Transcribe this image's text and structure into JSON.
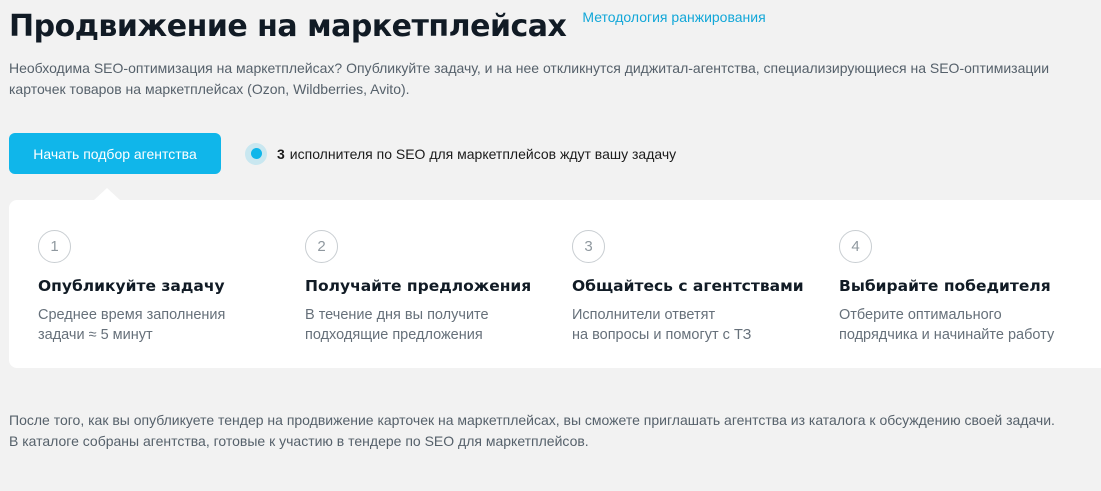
{
  "header": {
    "title": "Продвижение на маркетплейсах",
    "methodology_link": "Методология ранжирования"
  },
  "intro": {
    "text": "Необходима SEO-оптимизация на маркетплейсах? Опубликуйте задачу, и на нее откликнутся диджитал-агентства, специализирующиеся на SEO-оптимизации карточек товаров на маркетплейсах (Ozon, Wildberries, Avito)."
  },
  "cta": {
    "button_label": "Начать подбор агентства",
    "status_count": "3",
    "status_text": "исполнителя по SEO для маркетплейсов ждут вашу задачу"
  },
  "steps": [
    {
      "number": "1",
      "title": "Опубликуйте задачу",
      "desc_line1": "Среднее время заполнения",
      "desc_line2": "задачи ≈ 5 минут"
    },
    {
      "number": "2",
      "title": "Получайте предложения",
      "desc_line1": "В течение дня вы получите",
      "desc_line2": "подходящие предложения"
    },
    {
      "number": "3",
      "title": "Общайтесь с агентствами",
      "desc_line1": "Исполнители ответят",
      "desc_line2": "на вопросы и помогут с ТЗ"
    },
    {
      "number": "4",
      "title": "Выбирайте победителя",
      "desc_line1": "Отберите оптимального",
      "desc_line2": "подрядчика и начинайте работу"
    }
  ],
  "footer": {
    "paragraph1": "После того, как вы опубликуете тендер на продвижение карточек на маркетплейсах, вы сможете приглашать агентства из каталога к обсуждению своей задачи.",
    "paragraph2": "В каталоге собраны агентства, готовые к участию в тендере по SEO для маркетплейсов."
  },
  "colors": {
    "accent": "#10b6ea",
    "link": "#12a7d8",
    "background": "#f2f2f2",
    "card": "#ffffff",
    "title": "#111b25",
    "muted_text": "#56616b"
  }
}
